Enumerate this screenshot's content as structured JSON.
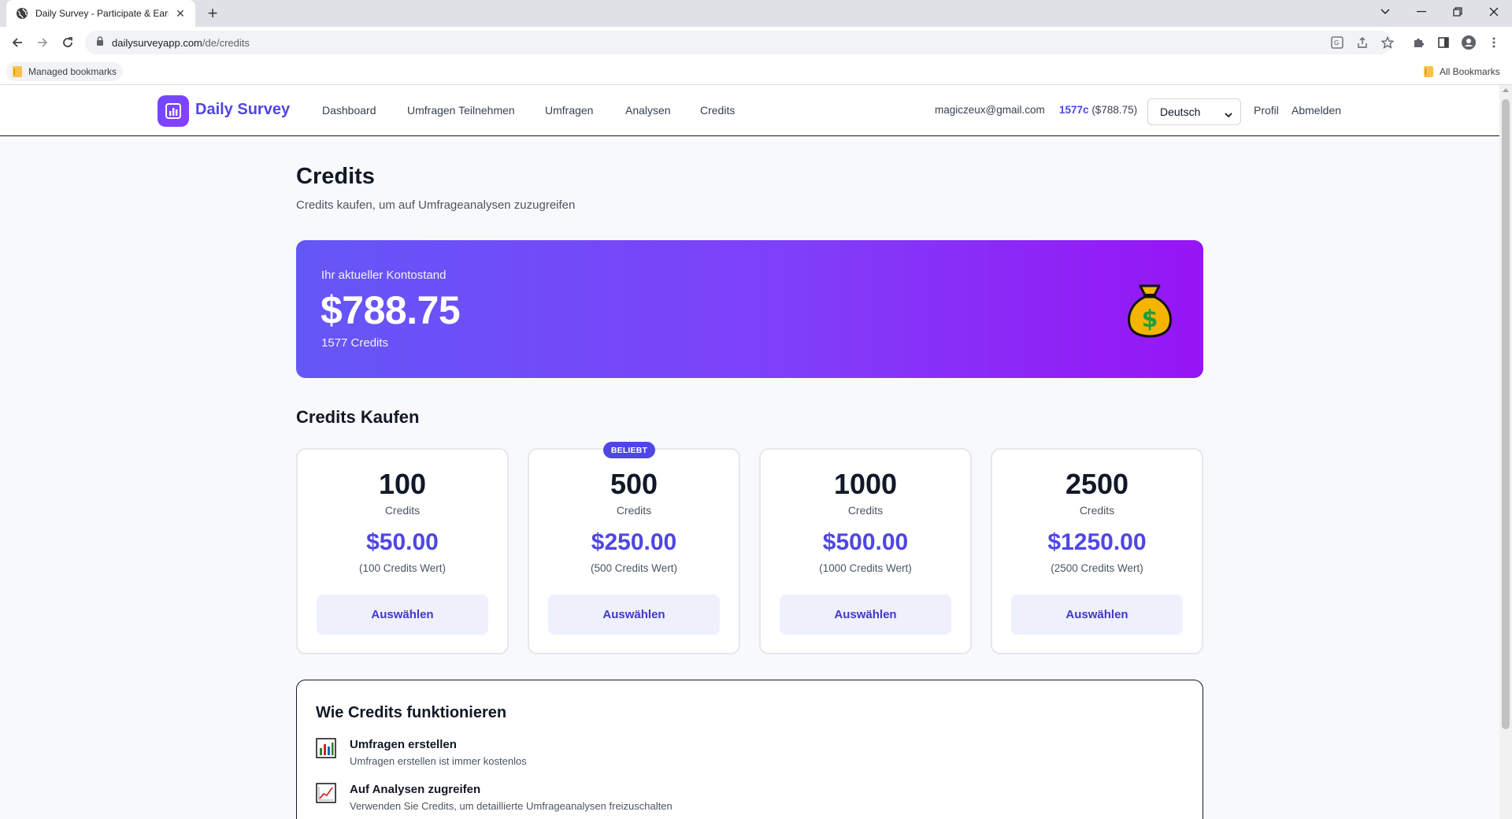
{
  "browser": {
    "tab_title": "Daily Survey - Participate & Earn",
    "url_host": "dailysurveyapp.com",
    "url_path": "/de/credits",
    "bookmarks": {
      "managed": "Managed bookmarks",
      "all": "All Bookmarks"
    }
  },
  "nav": {
    "brand": "Daily Survey",
    "links": [
      "Dashboard",
      "Umfragen Teilnehmen",
      "Umfragen",
      "Analysen",
      "Credits"
    ],
    "email": "magiczeux@gmail.com",
    "credits_short": "1577c",
    "credits_value": "($788.75)",
    "language": "Deutsch",
    "profile": "Profil",
    "logout": "Abmelden"
  },
  "page": {
    "title": "Credits",
    "subtitle": "Credits kaufen, um auf Umfrageanalysen zuzugreifen"
  },
  "balance": {
    "label": "Ihr aktueller Kontostand",
    "amount": "$788.75",
    "credits": "1577 Credits"
  },
  "buy": {
    "title": "Credits Kaufen",
    "packages": [
      {
        "amount": "100",
        "unit": "Credits",
        "price": "$50.00",
        "worth": "(100 Credits Wert)",
        "button": "Auswählen",
        "badge": ""
      },
      {
        "amount": "500",
        "unit": "Credits",
        "price": "$250.00",
        "worth": "(500 Credits Wert)",
        "button": "Auswählen",
        "badge": "BELIEBT"
      },
      {
        "amount": "1000",
        "unit": "Credits",
        "price": "$500.00",
        "worth": "(1000 Credits Wert)",
        "button": "Auswählen",
        "badge": ""
      },
      {
        "amount": "2500",
        "unit": "Credits",
        "price": "$1250.00",
        "worth": "(2500 Credits Wert)",
        "button": "Auswählen",
        "badge": ""
      }
    ]
  },
  "how": {
    "title": "Wie Credits funktionieren",
    "items": [
      {
        "icon": "bar-chart-icon",
        "title": "Umfragen erstellen",
        "desc": "Umfragen erstellen ist immer kostenlos"
      },
      {
        "icon": "trend-chart-icon",
        "title": "Auf Analysen zugreifen",
        "desc": "Verwenden Sie Credits, um detaillierte Umfrageanalysen freizuschalten"
      }
    ]
  },
  "colors": {
    "accent": "#4f46e5",
    "gradient_start": "#6457f7",
    "gradient_end": "#9714f5"
  }
}
